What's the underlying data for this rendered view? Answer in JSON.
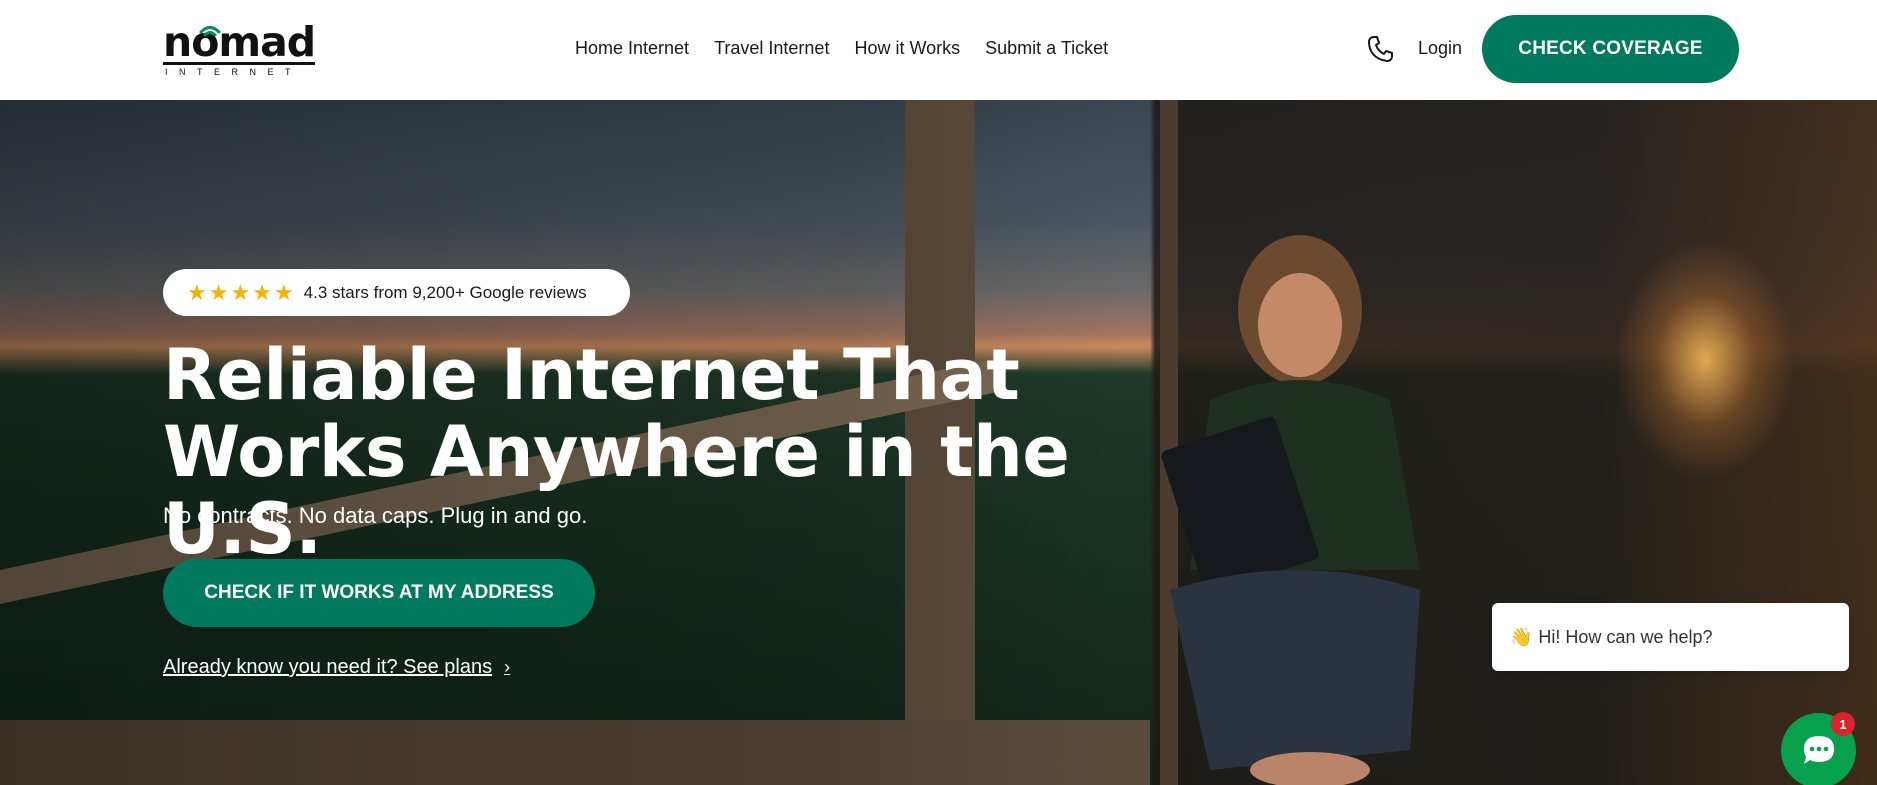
{
  "brand": {
    "logo_word": "nomad",
    "logo_sub": "INTERNET"
  },
  "nav": {
    "items": [
      {
        "label": "Home Internet"
      },
      {
        "label": "Travel Internet"
      },
      {
        "label": "How it Works"
      },
      {
        "label": "Submit a Ticket"
      }
    ],
    "login": "Login",
    "cta": "CHECK COVERAGE",
    "phone_icon": "phone-icon"
  },
  "hero": {
    "rating_stars": 5,
    "rating_text": "4.3 stars from 9,200+ Google reviews",
    "headline_line1": "Reliable Internet That",
    "headline_line2": "Works Anywhere in the U.S.",
    "subhead": "No contracts. No data caps. Plug in and go.",
    "cta": "CHECK IF IT WORKS AT MY ADDRESS",
    "plans_link": "Already know you need it? See plans"
  },
  "chat": {
    "greeting": "Hi! How can we help?",
    "badge_count": "1"
  },
  "colors": {
    "accent": "#007a5c",
    "star": "#f5b400",
    "chat_green": "#07a04c",
    "badge_red": "#d9232e"
  }
}
